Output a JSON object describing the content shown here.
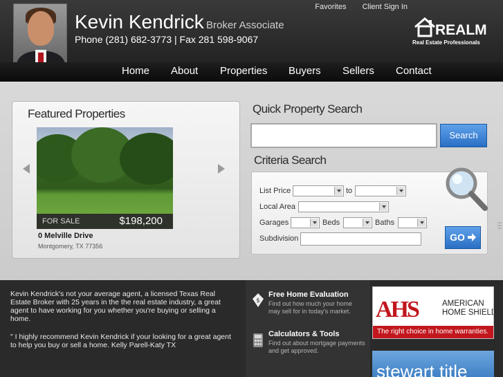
{
  "header": {
    "agent_name": "Kevin Kendrick",
    "agent_title": "Broker Associate",
    "contact": "Phone (281) 682-3773 | Fax 281 598-9067",
    "top_links": [
      "Favorites",
      "Client Sign In"
    ],
    "logo": {
      "word": "REALM",
      "subtitle": "Real Estate Professionals"
    }
  },
  "nav": [
    "Home",
    "About",
    "Properties",
    "Buyers",
    "Sellers",
    "Contact"
  ],
  "featured": {
    "title": "Featured Properties",
    "status": "FOR SALE",
    "price": "$198,200",
    "address": "0 Melville Drive",
    "city": "Montgomery, TX 77356"
  },
  "quick_search": {
    "title": "Quick Property Search",
    "input_value": "",
    "button": "Search"
  },
  "criteria": {
    "title": "Criteria Search",
    "list_price": "List Price",
    "to": "to",
    "local_area": "Local Area",
    "garages": "Garages",
    "beds": "Beds",
    "baths": "Baths",
    "subdivision": "Subdivision",
    "go": "GO"
  },
  "about": {
    "text": "Kevin Kendrick's not your average agent, a licensed Texas Real Estate Broker with 25 years in the the real estate industry, a great agent to have working for you whether you're buying or selling a home.",
    "quote": "\" I highly recommend Kevin Kendrick if your looking for a great agent to help you buy or sell a home. Kelly Parell-Katy TX"
  },
  "features": [
    {
      "title": "Free Home Evaluation",
      "desc": "Find out how much your home may sell for in today's market."
    },
    {
      "title": "Calculators & Tools",
      "desc": "Find out about mortgage payments and get approved."
    }
  ],
  "ads": {
    "ahs": {
      "logo": "AHS",
      "name": "AMERICAN HOME SHIELD",
      "tag": "The right choice in home warranties."
    },
    "stewart": {
      "text": "stewart title"
    }
  },
  "colors": {
    "accent_blue": "#2a6fc4",
    "ahs_red": "#c2161e",
    "header_dark": "#1c1c1c"
  }
}
